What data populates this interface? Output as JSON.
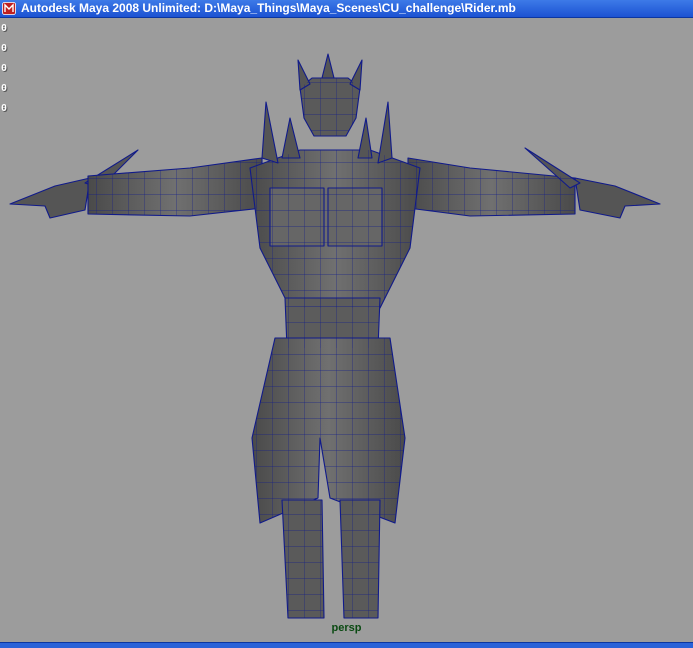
{
  "window": {
    "title": "Autodesk Maya 2008 Unlimited: D:\\Maya_Things\\Maya_Scenes\\CU_challenge\\Rider.mb"
  },
  "viewport": {
    "hud_values": [
      "0",
      "0",
      "0",
      "0",
      "0"
    ],
    "camera": "persp",
    "colors": {
      "background": "#9c9c9c",
      "wireframe": "#101a8a",
      "mesh": "#5e5e5e",
      "camera_label": "#0a4a12"
    }
  },
  "icons": {
    "app": "maya-app-icon"
  }
}
